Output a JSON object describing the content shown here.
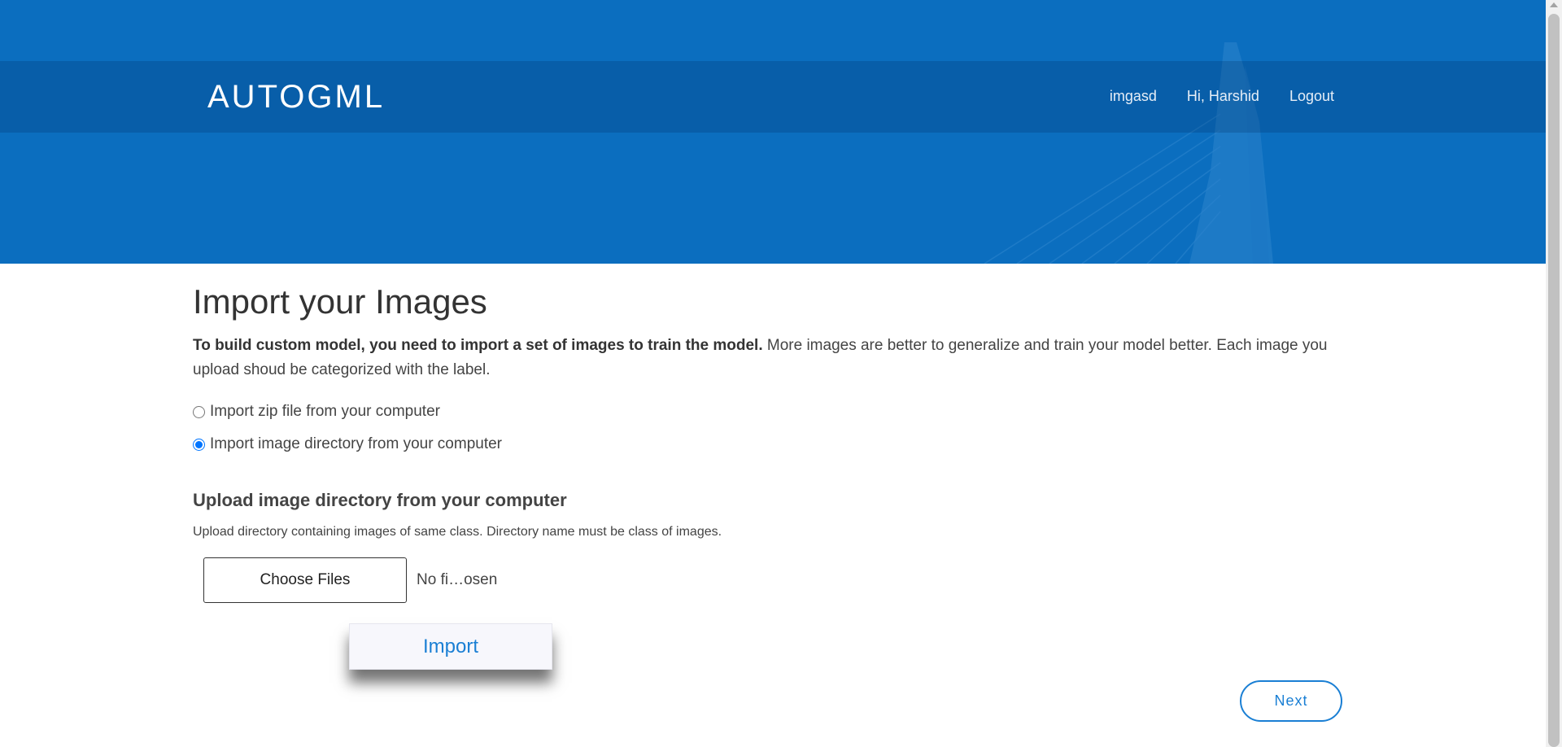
{
  "header": {
    "brand": "AUTOGML",
    "nav": [
      {
        "label": "imgasd"
      },
      {
        "label": "Hi, Harshid"
      },
      {
        "label": "Logout"
      }
    ]
  },
  "main": {
    "title": "Import your Images",
    "intro_bold": "To build custom model, you need to import a set of images to train the model.",
    "intro_rest": " More images are better to generalize and train your model better. Each image you upload shoud be categorized with the label.",
    "options": [
      {
        "label": "Import zip file from your computer",
        "checked": false
      },
      {
        "label": "Import image directory from your computer",
        "checked": true
      }
    ],
    "upload": {
      "title": "Upload image directory from your computer",
      "description": "Upload directory containing images of same class. Directory name must be class of images.",
      "choose_label": "Choose Files",
      "file_status": "No fi…osen"
    },
    "import_label": "Import",
    "next_label": "Next"
  },
  "colors": {
    "header_bg": "#0b6ebf",
    "accent": "#1a7fd4"
  }
}
